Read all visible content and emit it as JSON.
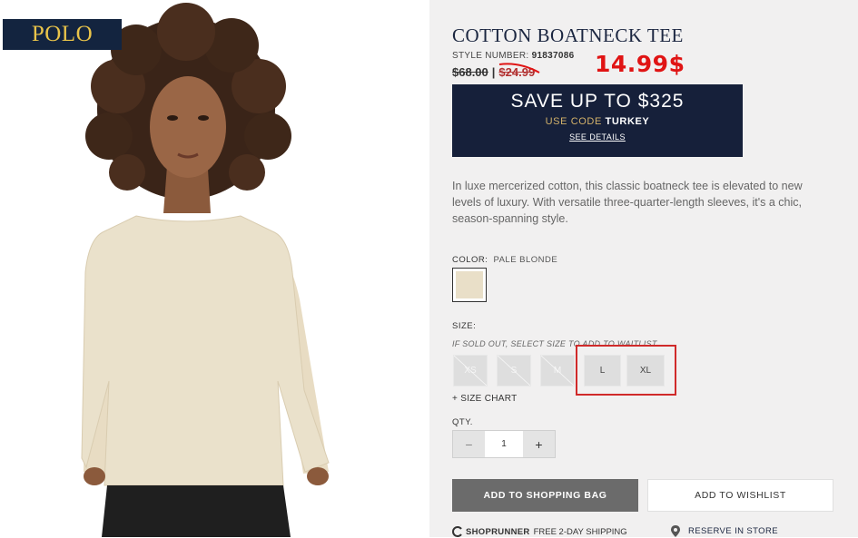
{
  "brand": {
    "logo_text": "POLO"
  },
  "product": {
    "title": "COTTON BOATNECK TEE",
    "style_label": "STYLE NUMBER:",
    "style_number": "91837086",
    "price_original": "$68.00",
    "price_separator": "|",
    "price_sale": "$24.99",
    "price_annotation": "14.99$",
    "description": "In luxe mercerized cotton, this classic boatneck tee is elevated to new levels of luxury. With versatile three-quarter-length sleeves, it's a chic, season-spanning style."
  },
  "promo": {
    "headline": "SAVE UP TO $325",
    "code_label": "USE CODE",
    "code": "TURKEY",
    "details_link": "SEE DETAILS"
  },
  "color": {
    "label": "COLOR:",
    "value": "PALE BLONDE",
    "swatch_hex": "#e9dfc8"
  },
  "size": {
    "label": "SIZE:",
    "hint": "IF SOLD OUT, SELECT SIZE TO ADD TO WAITLIST",
    "options": [
      {
        "label": "XS",
        "sold_out": true
      },
      {
        "label": "S",
        "sold_out": true
      },
      {
        "label": "M",
        "sold_out": true
      },
      {
        "label": "L",
        "sold_out": false
      },
      {
        "label": "XL",
        "sold_out": false
      }
    ],
    "chart_link": "+ SIZE CHART"
  },
  "quantity": {
    "label": "QTY.",
    "minus": "−",
    "value": "1",
    "plus": "+"
  },
  "actions": {
    "add_to_bag": "ADD TO SHOPPING BAG",
    "add_to_wishlist": "ADD TO WISHLIST"
  },
  "footer": {
    "shoprunner_brand": "SHOPRUNNER",
    "shoprunner_text": "FREE 2-DAY SHIPPING",
    "reserve_text": "RESERVE IN STORE"
  },
  "colors": {
    "navy": "#16203a",
    "logo_gold": "#e9c44a",
    "annotation_red": "#e01414",
    "button_gray": "#6b6b6b"
  }
}
